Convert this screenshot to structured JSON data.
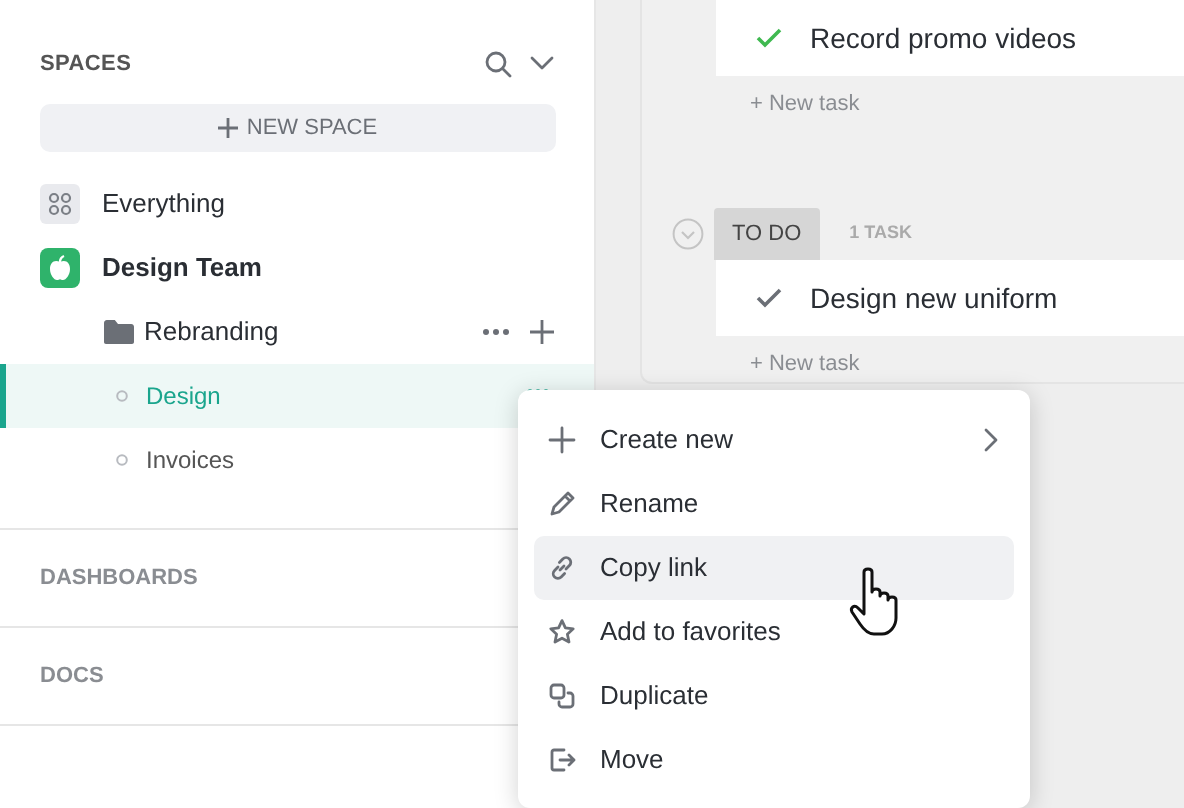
{
  "sidebar": {
    "title": "SPACES",
    "new_space_button": "NEW SPACE",
    "items": [
      {
        "label": "Everything",
        "kind": "everything"
      },
      {
        "label": "Design Team",
        "kind": "space",
        "children": [
          {
            "label": "Rebranding",
            "kind": "folder",
            "children": [
              {
                "label": "Design",
                "kind": "list",
                "selected": true
              },
              {
                "label": "Invoices",
                "kind": "list",
                "selected": false
              }
            ]
          }
        ]
      }
    ],
    "sections": [
      "DASHBOARDS",
      "DOCS"
    ]
  },
  "board": {
    "groups": [
      {
        "tasks": [
          {
            "name": "Record promo videos",
            "done": true
          }
        ],
        "new_task": "+ New task"
      },
      {
        "status": "TO DO",
        "count": "1 TASK",
        "tasks": [
          {
            "name": "Design new uniform",
            "done": false
          }
        ],
        "new_task": "+ New task"
      }
    ]
  },
  "context_menu": {
    "items": [
      {
        "label": "Create new",
        "kind": "plus",
        "submenu": true,
        "hovered": false
      },
      {
        "label": "Rename",
        "kind": "pencil",
        "submenu": false,
        "hovered": false
      },
      {
        "label": "Copy link",
        "kind": "link",
        "submenu": false,
        "hovered": true
      },
      {
        "label": "Add to favorites",
        "kind": "star",
        "submenu": false,
        "hovered": false
      },
      {
        "label": "Duplicate",
        "kind": "duplicate",
        "submenu": false,
        "hovered": false
      },
      {
        "label": "Move",
        "kind": "move",
        "submenu": false,
        "hovered": false
      }
    ]
  }
}
